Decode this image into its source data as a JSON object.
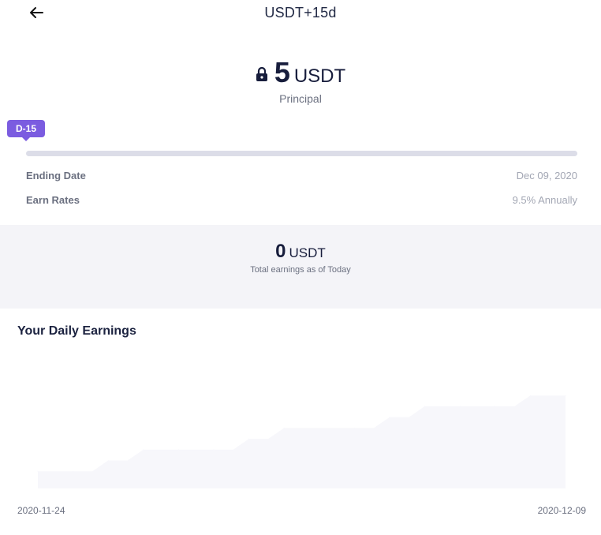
{
  "header": {
    "title": "USDT+15d",
    "back_icon": "arrow-left-icon"
  },
  "principal": {
    "lock_icon": "lock-icon",
    "amount": "5",
    "unit": "USDT",
    "label": "Principal"
  },
  "progress": {
    "badge": "D-15",
    "fraction": 0
  },
  "details": [
    {
      "label": "Ending Date",
      "value": "Dec 09, 2020"
    },
    {
      "label": "Earn Rates",
      "value": "9.5% Annually"
    }
  ],
  "earnings": {
    "amount": "0",
    "unit": "USDT",
    "label": "Total earnings as of Today"
  },
  "daily_earnings": {
    "title": "Your Daily Earnings"
  },
  "colors": {
    "accent": "#7b5ce0",
    "track": "#dcdde8",
    "panel": "#f4f4f8",
    "chart_fill": "#f7f7fb"
  },
  "chart_data": {
    "type": "area",
    "x": [
      "2020-11-24",
      "2020-11-25",
      "2020-11-26",
      "2020-11-27",
      "2020-11-28",
      "2020-11-29",
      "2020-11-30",
      "2020-12-01",
      "2020-12-02",
      "2020-12-03",
      "2020-12-04",
      "2020-12-05",
      "2020-12-06",
      "2020-12-07",
      "2020-12-08",
      "2020-12-09"
    ],
    "values": [
      1,
      1,
      2,
      3,
      3,
      3,
      4,
      5,
      5,
      5,
      6,
      7,
      7,
      7,
      8,
      8
    ],
    "x_tick_labels": [
      "2020-11-24",
      "2020-12-09"
    ],
    "grid": false
  }
}
